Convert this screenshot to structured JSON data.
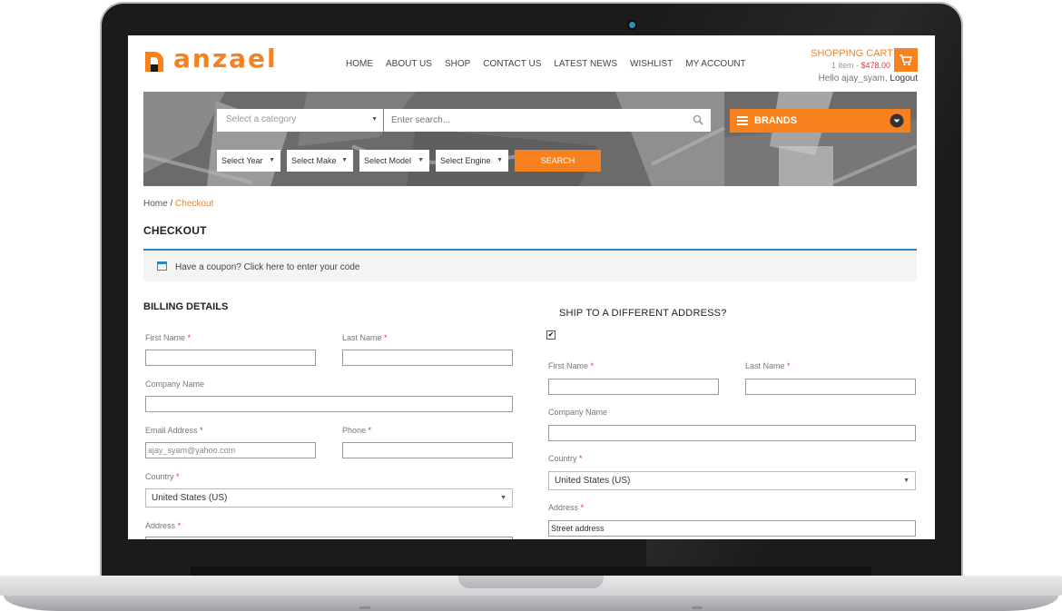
{
  "colors": {
    "accent": "#f7811f",
    "info": "#2b87c0",
    "required": "#d63a3a"
  },
  "brand": {
    "logo_text": "anzael"
  },
  "nav": {
    "items": [
      "HOME",
      "ABOUT US",
      "SHOP",
      "CONTACT US",
      "LATEST NEWS",
      "WISHLIST",
      "MY ACCOUNT"
    ]
  },
  "cart": {
    "title": "SHOPPING CART",
    "items": "1 item",
    "sep": " - ",
    "total": "$478.00",
    "icon": "cart-icon"
  },
  "user": {
    "greeting": "Hello ajay_syam,",
    "logout": "Logout"
  },
  "search": {
    "category_placeholder": "Select a category",
    "placeholder": "Enter search...",
    "brands_label": "BRANDS",
    "year": "Select Year",
    "make": "Select Make",
    "model": "Select Model",
    "engine": "Select Engine",
    "button": "SEARCH"
  },
  "breadcrumb": {
    "home": "Home",
    "sep": " / ",
    "current": "Checkout"
  },
  "page": {
    "title": "CHECKOUT",
    "coupon_text": "Have a coupon? Click here to enter your code"
  },
  "billing": {
    "heading": "BILLING DETAILS",
    "first_name": "First Name",
    "last_name": "Last Name",
    "company": "Company Name",
    "email": "Email Address",
    "email_value": "ajay_syam@yahoo.com",
    "phone": "Phone",
    "country": "Country",
    "country_value": "United States (US)",
    "address": "Address",
    "required_mark": "*"
  },
  "shipping": {
    "heading": "SHIP TO A DIFFERENT ADDRESS?",
    "checked_mark": "✔",
    "first_name": "First Name",
    "last_name": "Last Name",
    "company": "Company Name",
    "country": "Country",
    "country_value": "United States (US)",
    "address": "Address",
    "address_placeholder": "Street address",
    "required_mark": "*"
  }
}
